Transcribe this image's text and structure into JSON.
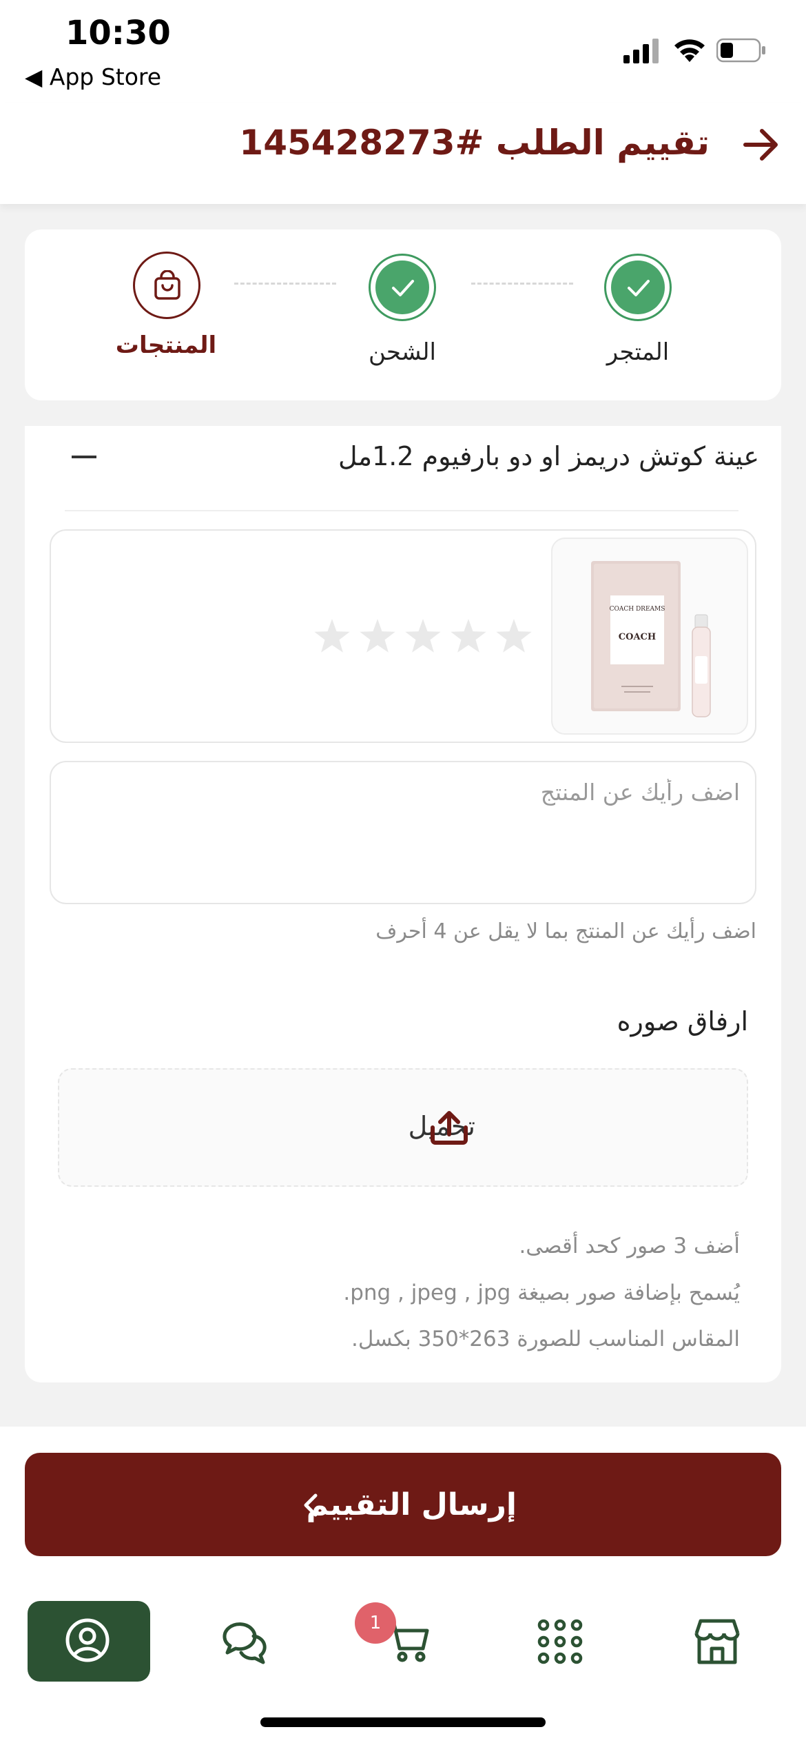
{
  "status_bar": {
    "time": "10:30",
    "back_app": "◀ App Store"
  },
  "header": {
    "title": "تقييم الطلب #145428273"
  },
  "stepper": {
    "steps": [
      {
        "label": "المتجر",
        "state": "done"
      },
      {
        "label": "الشحن",
        "state": "done"
      },
      {
        "label": "المنتجات",
        "state": "active"
      }
    ]
  },
  "product": {
    "title": "عينة كوتش دريمز او دو بارفيوم 1.2مل",
    "rating": 0,
    "max_rating": 5,
    "image_brand": "COACH DREAMS",
    "image_brand_sub": "COACH"
  },
  "comment": {
    "placeholder": "اضف رأيك عن المنتج",
    "value": "",
    "hint": "اضف رأيك عن المنتج بما لا يقل عن 4 أحرف"
  },
  "attachment": {
    "title": "ارفاق صوره",
    "upload_label": "تحميل",
    "notes": [
      "أضف 3 صور كحد أقصى.",
      "يُسمح بإضافة صور بصيغة png , jpeg , jpg.",
      "المقاس المناسب للصورة 263*350 بكسل."
    ]
  },
  "submit": {
    "label": "إرسال التقييم"
  },
  "bottom_nav": {
    "items": [
      {
        "icon": "profile-icon",
        "active": true
      },
      {
        "icon": "chat-icon",
        "active": false
      },
      {
        "icon": "cart-icon",
        "active": false,
        "badge": "1"
      },
      {
        "icon": "grid-icon",
        "active": false
      },
      {
        "icon": "store-icon",
        "active": false
      }
    ]
  },
  "colors": {
    "brand": "#6e1a15",
    "success": "#4aa56b",
    "nav_active": "#2c5233",
    "badge": "#e0626a"
  }
}
